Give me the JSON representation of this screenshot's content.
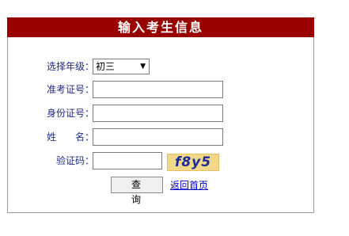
{
  "header": {
    "title": "输入考生信息"
  },
  "form": {
    "grade_label": "选择年级：",
    "grade_selected": "初三",
    "exam_no_label": "准考证号：",
    "exam_no_value": "",
    "id_no_label": "身份证号：",
    "id_no_value": "",
    "name_label": "姓名：",
    "name_value": "",
    "captcha_label": "验证码：",
    "captcha_value": "",
    "captcha_image_text": "f8y5"
  },
  "actions": {
    "query_label": "查 询",
    "back_label": "返回首页"
  },
  "colors": {
    "header_bg": "#990000",
    "label_text": "#1f2a8a",
    "link": "#0000cc",
    "captcha_bg": "#f2d98a"
  }
}
